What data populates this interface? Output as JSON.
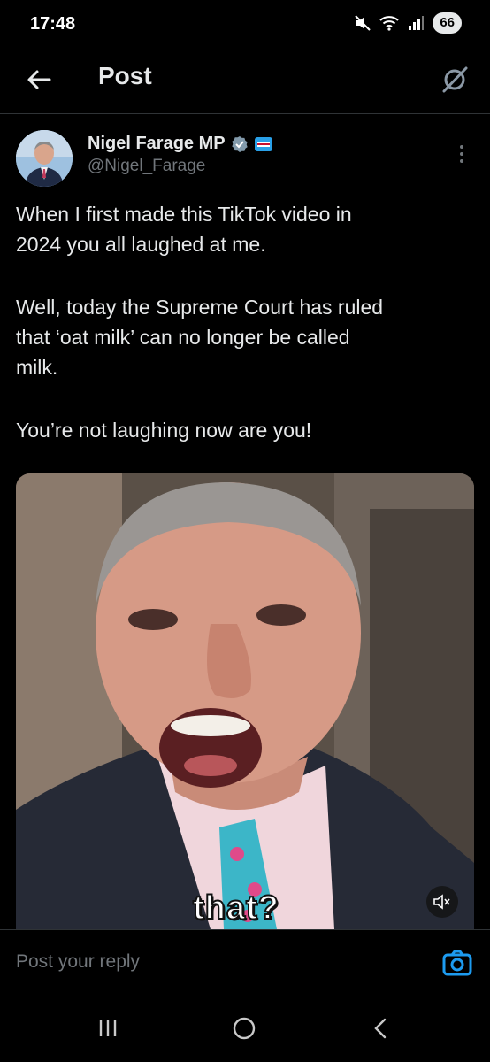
{
  "status_bar": {
    "time": "17:48",
    "battery": "66"
  },
  "header": {
    "title": "Post"
  },
  "tweet": {
    "author_name": "Nigel Farage MP",
    "handle": "@Nigel_Farage",
    "text_lines": [
      "When I first made this TikTok video in",
      "2024 you all laughed at me.",
      "",
      "Well, today the Supreme Court has ruled",
      "that ‘oat milk’ can no longer be called",
      "milk.",
      "",
      "You’re not laughing now are you!"
    ],
    "video_caption": "that?"
  },
  "reply": {
    "placeholder": "Post your reply"
  },
  "colors": {
    "accent": "#1d9bf0",
    "background": "#000000",
    "muted": "#71767b",
    "verified": "#829aab"
  }
}
